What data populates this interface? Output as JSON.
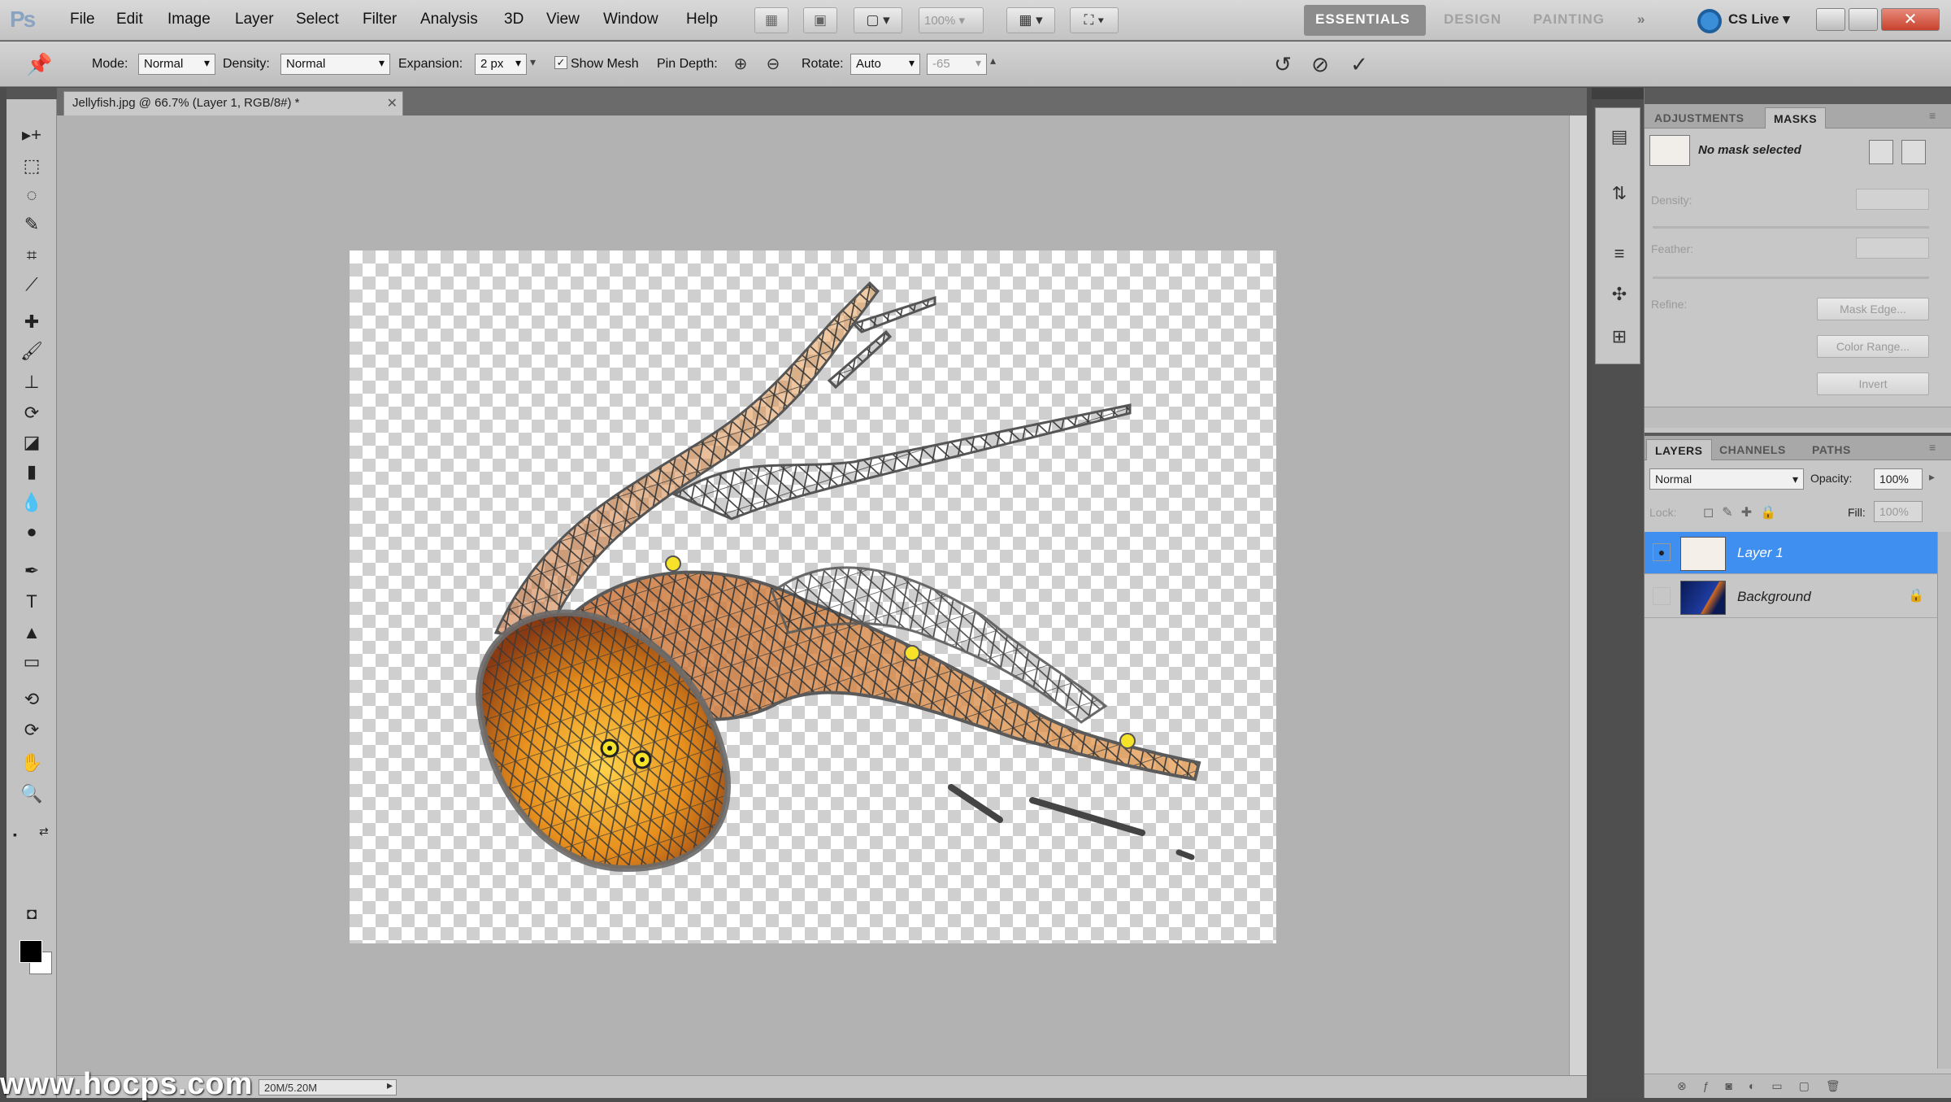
{
  "app": {
    "logo": "Ps"
  },
  "menu": [
    "File",
    "Edit",
    "Image",
    "Layer",
    "Select",
    "Filter",
    "Analysis",
    "3D",
    "View",
    "Window",
    "Help"
  ],
  "menubar": {
    "zoom": "100%",
    "workspaces": [
      "ESSENTIALS",
      "DESIGN",
      "PAINTING"
    ],
    "more": "»",
    "cs_live": "CS Live"
  },
  "options": {
    "mode_label": "Mode:",
    "mode_value": "Normal",
    "density_label": "Density:",
    "density_value": "Normal",
    "expansion_label": "Expansion:",
    "expansion_value": "2 px",
    "show_mesh_label": "Show Mesh",
    "pin_depth_label": "Pin Depth:",
    "rotate_label": "Rotate:",
    "rotate_value": "Auto",
    "rotate_angle": "-65"
  },
  "document": {
    "tab_title": "Jellyfish.jpg @ 66.7% (Layer 1, RGB/8#) *",
    "status": "20M/5.20M",
    "watermark": "www.hocps.com"
  },
  "masks_panel": {
    "tabs": [
      "ADJUSTMENTS",
      "MASKS"
    ],
    "active_tab": "MASKS",
    "no_mask": "No mask selected",
    "density_label": "Density:",
    "feather_label": "Feather:",
    "refine_label": "Refine:",
    "mask_edge": "Mask Edge...",
    "color_range": "Color Range...",
    "invert": "Invert"
  },
  "layers_panel": {
    "tabs": [
      "LAYERS",
      "CHANNELS",
      "PATHS"
    ],
    "active_tab": "LAYERS",
    "blend_mode": "Normal",
    "opacity_label": "Opacity:",
    "opacity_value": "100%",
    "lock_label": "Lock:",
    "fill_label": "Fill:",
    "fill_value": "100%",
    "layers": [
      {
        "name": "Layer 1",
        "selected": true
      },
      {
        "name": "Background",
        "selected": false
      }
    ]
  },
  "colors": {
    "accent": "#3e8ff0",
    "pin": "#f7e22a"
  }
}
